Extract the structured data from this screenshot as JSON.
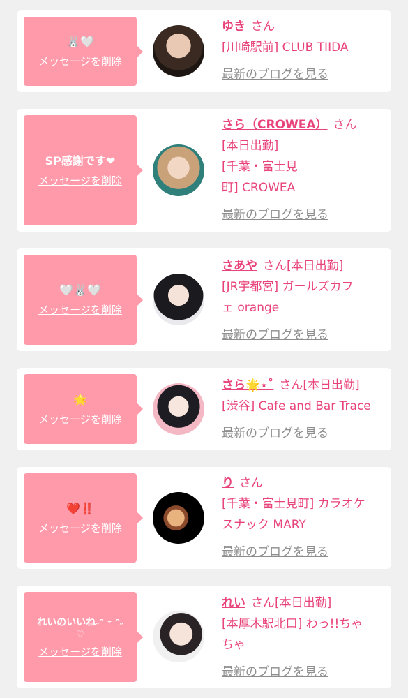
{
  "delete_label": "メッセージを削除",
  "blog_label": "最新のブログを見る",
  "san": "さん",
  "cards": [
    {
      "message": "🐰🤍",
      "name": "ゆき",
      "status": "",
      "shop_lines": [
        "[川崎駅前] CLUB TIIDA"
      ]
    },
    {
      "message": "SP感謝です❤",
      "name": "さら（CROWEA）",
      "status": "",
      "shop_lines": [
        "[本日出勤]",
        "[千葉・富士見",
        "町] CROWEA"
      ]
    },
    {
      "message": "🤍🐰🤍",
      "name": "さあや",
      "status": "[本日出勤]",
      "shop_lines": [
        "[JR宇都宮] ガールズカフ",
        "ェ orange"
      ]
    },
    {
      "message": "🌟",
      "name": "さら🌟⋆˚",
      "status": "[本日出勤]",
      "shop_lines": [
        "[渋谷] Cafe and Bar Trace"
      ]
    },
    {
      "message": "❤️‼️",
      "name": "り",
      "status": "",
      "shop_lines": [
        "[千葉・富士見町] カラオケ",
        "スナック MARY"
      ]
    },
    {
      "message": "れいのいいね˶ᵔ ᵕ ᵔ˶",
      "message2": "♡",
      "name": "れい",
      "status": "[本日出勤]",
      "shop_lines": [
        "[本厚木駅北口] わっ!!ちゃ",
        "ちゃ"
      ]
    }
  ],
  "colors": {
    "accent": "#e8437a",
    "bubble": "#ff9aab",
    "link_gray": "#8e8e8e"
  }
}
